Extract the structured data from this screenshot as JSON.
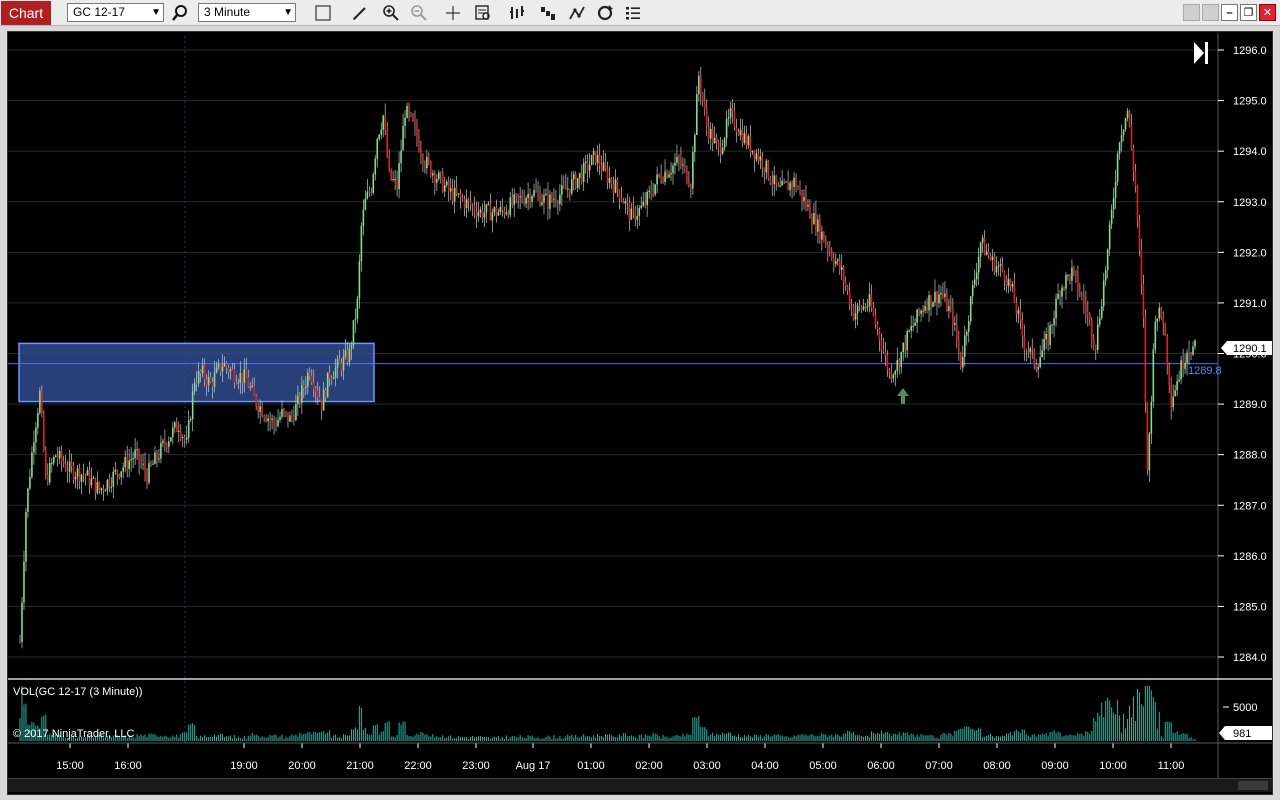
{
  "toolbar": {
    "tab_label": "Chart",
    "instrument": "GC 12-17",
    "interval": "3 Minute",
    "icons": [
      "search-icon",
      "rectangle-icon",
      "pencil-icon",
      "zoom-in-icon",
      "zoom-out-icon",
      "crosshair-icon",
      "data-box-icon",
      "bar-type-icon",
      "chart-style-icon",
      "drawing-tools-icon",
      "reload-icon",
      "properties-icon"
    ],
    "window_buttons": [
      "minimize",
      "maximize",
      "restore",
      "close"
    ]
  },
  "chart_data": {
    "type": "candlestick",
    "instrument": "GC 12-17",
    "interval": "3 Minute",
    "colors": {
      "background": "#000000",
      "up": "#7fe08a",
      "down": "#e02020",
      "wick": "#c8c8c8",
      "grid": "#2a2a2a",
      "line": "#4a6dff",
      "zone_fill": "#2f4b8c",
      "zone_border": "#6e94ff",
      "volume": "#2bb3a3"
    },
    "price_axis": {
      "min": 1284.0,
      "max": 1296.0,
      "ticks": [
        "1296.0",
        "1295.0",
        "1294.0",
        "1293.0",
        "1292.0",
        "1291.0",
        "1290.0",
        "1289.0",
        "1288.0",
        "1287.0",
        "1286.0",
        "1285.0",
        "1284.0"
      ]
    },
    "time_axis": {
      "ticks": [
        "15:00",
        "16:00",
        "19:00",
        "20:00",
        "21:00",
        "22:00",
        "23:00",
        "Aug 17",
        "01:00",
        "02:00",
        "03:00",
        "04:00",
        "05:00",
        "06:00",
        "07:00",
        "08:00",
        "09:00",
        "10:00",
        "11:00"
      ]
    },
    "last_price_label": "1290.1",
    "horizontal_line_label": "1289.8",
    "horizontal_line_price": 1289.8,
    "zone": {
      "price_top": 1290.2,
      "price_bottom": 1289.05
    },
    "price_path": [
      [
        0,
        1284.3
      ],
      [
        3,
        1286.9
      ],
      [
        7,
        1288.4
      ],
      [
        10,
        1289.2
      ],
      [
        13,
        1287.5
      ],
      [
        18,
        1288.0
      ],
      [
        25,
        1287.7
      ],
      [
        33,
        1287.6
      ],
      [
        40,
        1287.3
      ],
      [
        50,
        1287.7
      ],
      [
        58,
        1288.0
      ],
      [
        64,
        1287.6
      ],
      [
        74,
        1288.3
      ],
      [
        80,
        1288.6
      ],
      [
        84,
        1288.2
      ],
      [
        88,
        1289.5
      ],
      [
        92,
        1289.6
      ],
      [
        96,
        1289.4
      ],
      [
        102,
        1289.8
      ],
      [
        108,
        1289.6
      ],
      [
        114,
        1289.5
      ],
      [
        118,
        1289.1
      ],
      [
        124,
        1288.8
      ],
      [
        128,
        1288.6
      ],
      [
        132,
        1288.8
      ],
      [
        136,
        1288.7
      ],
      [
        140,
        1289.0
      ],
      [
        146,
        1289.7
      ],
      [
        152,
        1289.0
      ],
      [
        156,
        1289.6
      ],
      [
        162,
        1289.8
      ],
      [
        166,
        1290.0
      ],
      [
        170,
        1291.0
      ],
      [
        172,
        1292.5
      ],
      [
        174,
        1293.0
      ],
      [
        177,
        1293.3
      ],
      [
        180,
        1294.3
      ],
      [
        183,
        1294.7
      ],
      [
        186,
        1293.5
      ],
      [
        190,
        1293.3
      ],
      [
        194,
        1294.8
      ],
      [
        198,
        1294.5
      ],
      [
        204,
        1293.8
      ],
      [
        210,
        1293.5
      ],
      [
        216,
        1293.2
      ],
      [
        224,
        1293.0
      ],
      [
        232,
        1292.8
      ],
      [
        242,
        1292.8
      ],
      [
        250,
        1293.0
      ],
      [
        258,
        1293.2
      ],
      [
        266,
        1293.0
      ],
      [
        274,
        1293.2
      ],
      [
        282,
        1293.5
      ],
      [
        290,
        1293.9
      ],
      [
        296,
        1293.5
      ],
      [
        302,
        1293.2
      ],
      [
        308,
        1292.7
      ],
      [
        314,
        1292.9
      ],
      [
        322,
        1293.5
      ],
      [
        332,
        1293.8
      ],
      [
        338,
        1293.4
      ],
      [
        342,
        1295.5
      ],
      [
        346,
        1294.5
      ],
      [
        352,
        1294.0
      ],
      [
        358,
        1294.7
      ],
      [
        366,
        1294.2
      ],
      [
        374,
        1293.8
      ],
      [
        382,
        1293.2
      ],
      [
        390,
        1293.4
      ],
      [
        398,
        1292.8
      ],
      [
        406,
        1292.2
      ],
      [
        414,
        1291.6
      ],
      [
        420,
        1290.8
      ],
      [
        428,
        1291.0
      ],
      [
        434,
        1290.2
      ],
      [
        438,
        1289.6
      ],
      [
        442,
        1289.8
      ],
      [
        448,
        1290.4
      ],
      [
        456,
        1291.0
      ],
      [
        464,
        1291.2
      ],
      [
        470,
        1290.7
      ],
      [
        474,
        1289.8
      ],
      [
        478,
        1290.8
      ],
      [
        484,
        1292.2
      ],
      [
        490,
        1291.8
      ],
      [
        496,
        1291.6
      ],
      [
        500,
        1291.2
      ],
      [
        506,
        1290.2
      ],
      [
        512,
        1289.8
      ],
      [
        518,
        1290.3
      ],
      [
        524,
        1291.3
      ],
      [
        530,
        1291.6
      ],
      [
        536,
        1291.0
      ],
      [
        542,
        1290.2
      ],
      [
        548,
        1292.0
      ],
      [
        554,
        1294.3
      ],
      [
        558,
        1294.8
      ],
      [
        562,
        1293.3
      ],
      [
        566,
        1290.6
      ],
      [
        568,
        1287.6
      ],
      [
        572,
        1290.8
      ],
      [
        576,
        1290.7
      ],
      [
        580,
        1289.1
      ],
      [
        584,
        1289.6
      ],
      [
        588,
        1290.1
      ],
      [
        592,
        1290.1
      ]
    ],
    "volume_axis": {
      "ticks": [
        "5000"
      ],
      "last_label": "981"
    },
    "volume_label": "VOL(GC 12-17 (3 Minute))",
    "copyright": "© 2017 NinjaTrader, LLC",
    "signal_arrow": "up-arrow-icon"
  }
}
